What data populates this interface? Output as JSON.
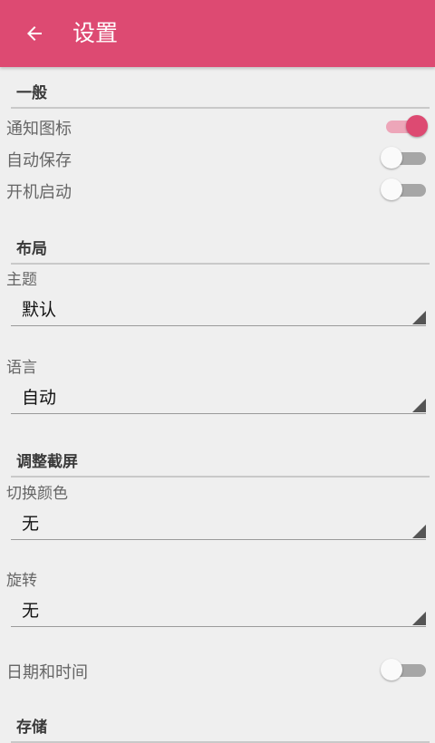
{
  "app_bar": {
    "title": "设置",
    "back_icon": "arrow-back-icon",
    "color": "#dd4a72"
  },
  "sections": {
    "general": {
      "title": "一般",
      "notification_icon": {
        "label": "通知图标",
        "on": true
      },
      "auto_save": {
        "label": "自动保存",
        "on": false
      },
      "start_on_boot": {
        "label": "开机启动",
        "on": false
      }
    },
    "layout": {
      "title": "布局",
      "theme": {
        "label": "主题",
        "value": "默认"
      },
      "language": {
        "label": "语言",
        "value": "自动"
      }
    },
    "screenshot": {
      "title": "调整截屏",
      "switch_color": {
        "label": "切换颜色",
        "value": "无"
      },
      "rotate": {
        "label": "旋转",
        "value": "无"
      },
      "date_time": {
        "label": "日期和时间",
        "on": false
      }
    },
    "storage": {
      "title": "存储"
    }
  },
  "colors": {
    "accent": "#dd4a72",
    "switch_off_track": "#a6a6a6",
    "switch_on_track": "#eda6b9"
  }
}
